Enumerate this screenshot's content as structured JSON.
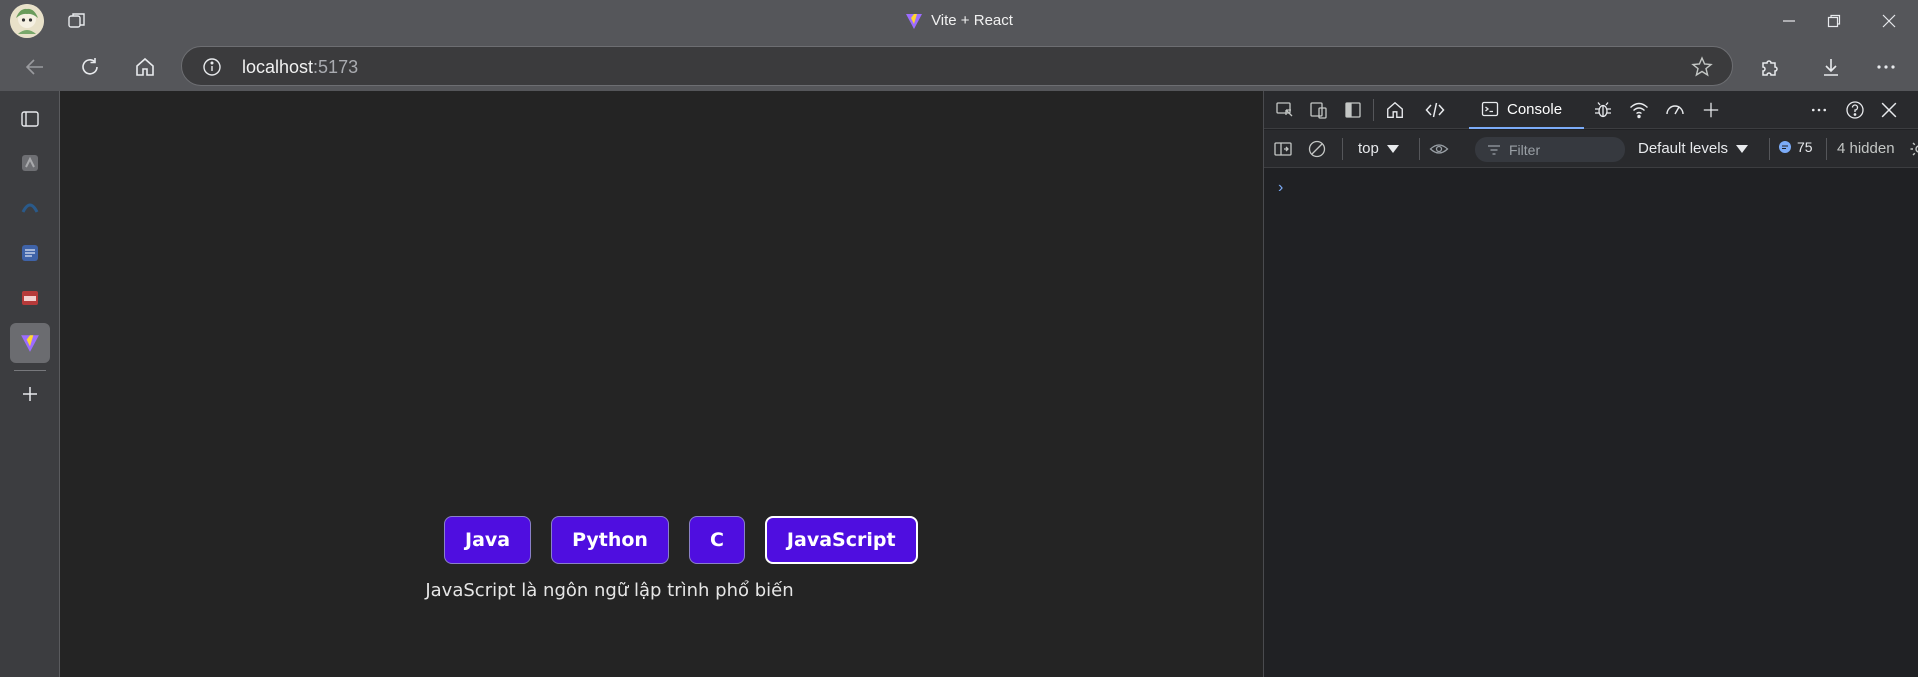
{
  "window": {
    "title": "Vite + React"
  },
  "toolbar": {
    "url_host": "localhost",
    "url_port": ":5173"
  },
  "sidebar": {
    "items": [
      {
        "icon": "tab-actions-icon"
      },
      {
        "icon": "app-icon"
      },
      {
        "icon": "app-icon"
      },
      {
        "icon": "document-app-icon"
      },
      {
        "icon": "pdf-app-icon"
      },
      {
        "icon": "vite-app-icon",
        "active": true
      },
      {
        "icon": "add-icon"
      }
    ]
  },
  "page": {
    "buttons": [
      {
        "label": "Java",
        "selected": false
      },
      {
        "label": "Python",
        "selected": false
      },
      {
        "label": "C",
        "selected": false
      },
      {
        "label": "JavaScript",
        "selected": true
      }
    ],
    "description": "JavaScript là ngôn ngữ lập trình phổ biến",
    "button_color": "#4f0ee0",
    "background": "#242424"
  },
  "devtools": {
    "active_tab": "Console",
    "context": "top",
    "filter_placeholder": "Filter",
    "levels": "Default levels",
    "issue_count": "75",
    "hidden": "4 hidden",
    "prompt": "›"
  }
}
